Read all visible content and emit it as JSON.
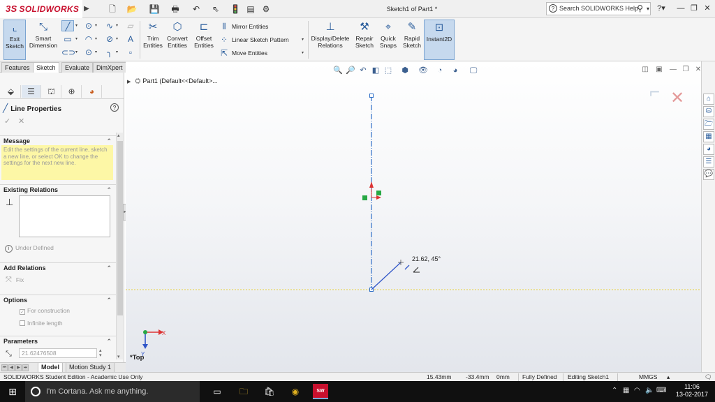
{
  "app": {
    "brand_mark": "3S",
    "brand_name": "SOLIDWORKS",
    "window_title": "Sketch1 of Part1 *",
    "search_placeholder": "Search SOLIDWORKS Help",
    "accent_color": "#c8102e"
  },
  "command_manager": {
    "exit_sketch": "Exit Sketch",
    "smart_dimension": "Smart Dimension",
    "trim_entities": "Trim Entities",
    "convert_entities": "Convert Entities",
    "offset_entities": "Offset Entities",
    "mirror_entities": "Mirror Entities",
    "linear_sketch_pattern": "Linear Sketch Pattern",
    "move_entities": "Move Entities",
    "display_delete_relations": "Display/Delete Relations",
    "repair_sketch": "Repair Sketch",
    "quick_snaps": "Quick Snaps",
    "rapid_sketch": "Rapid Sketch",
    "instant2d": "Instant2D"
  },
  "tabs": [
    "Features",
    "Sketch",
    "Evaluate",
    "DimXpert"
  ],
  "property_manager": {
    "title": "Line Properties",
    "message_header": "Message",
    "message_text": "Edit the settings of the current line, sketch a new line, or select OK to change the settings for the next new line.",
    "existing_relations_header": "Existing Relations",
    "status": "Under Defined",
    "add_relations_header": "Add Relations",
    "fix_label": "Fix",
    "options_header": "Options",
    "for_construction": "For construction",
    "infinite_length": "Infinite length",
    "parameters_header": "Parameters",
    "length_value": "21.62476508"
  },
  "bottom_tabs": [
    "Model",
    "Motion Study 1"
  ],
  "graphics": {
    "tree_node": "Part1  (Default<<Default>...",
    "dimension_readout": "21.62, 45°",
    "view_label": "*Top",
    "axis_x": "X",
    "axis_y": "Y"
  },
  "status_bar": {
    "edition": "SOLIDWORKS Student Edition - Academic Use Only",
    "x_coord": "15.43mm",
    "y_coord": "-33.4mm",
    "z_coord": "0mm",
    "definition": "Fully Defined",
    "mode": "Editing Sketch1",
    "units": "MMGS"
  },
  "taskbar": {
    "cortana": "I'm Cortana. Ask me anything.",
    "sw_badge": "SW",
    "time": "11:06",
    "date": "13-02-2017"
  }
}
